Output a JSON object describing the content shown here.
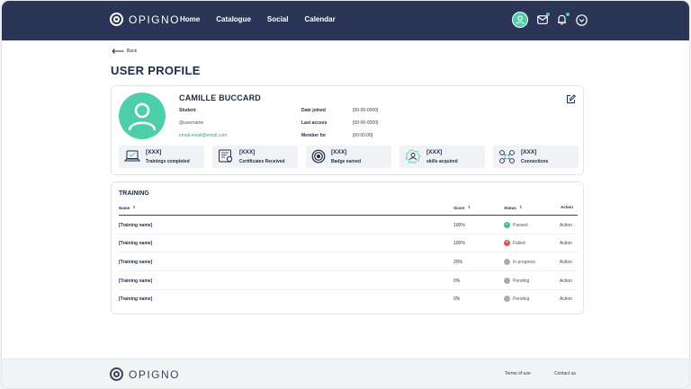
{
  "header": {
    "logo_text": "OPIGNO",
    "nav": [
      "Home",
      "Catalogue",
      "Social",
      "Calendar"
    ]
  },
  "back_label": "Back",
  "page_title": "USER PROFILE",
  "profile": {
    "name": "CAMILLE BUCCARD",
    "role": "Student",
    "username": "@username",
    "email": "email.email@email.com",
    "meta": [
      {
        "label": "Date joined",
        "value": "[00-00-0000]"
      },
      {
        "label": "Last access",
        "value": "[00-00-0000]"
      },
      {
        "label": "Member for",
        "value": "[00:00:00]"
      }
    ],
    "stats": [
      {
        "value": "[XXX]",
        "label": "Trainings completed",
        "icon": "laptop-icon"
      },
      {
        "value": "[XXX]",
        "label": "Certificates Received",
        "icon": "certificate-icon"
      },
      {
        "value": "[XXX]",
        "label": "Badge earned",
        "icon": "badge-icon"
      },
      {
        "value": "[XXX]",
        "label": "skills acquired",
        "icon": "skills-icon"
      },
      {
        "value": "[XXX]",
        "label": "Connections",
        "icon": "connections-icon"
      }
    ]
  },
  "training": {
    "title": "TRAINING",
    "columns": {
      "name": "Name",
      "score": "Score",
      "status": "Status",
      "action": "Action"
    },
    "rows": [
      {
        "name": "[Training name]",
        "score": "100%",
        "status": "Passed",
        "action": "Action"
      },
      {
        "name": "[Training name]",
        "score": "100%",
        "status": "Failed",
        "action": "Action"
      },
      {
        "name": "[Training name]",
        "score": "20%",
        "status": "In progress",
        "action": "Action"
      },
      {
        "name": "[Training name]",
        "score": "0%",
        "status": "Pending",
        "action": "Action"
      },
      {
        "name": "[Training name]",
        "score": "0%",
        "status": "Pending",
        "action": "Action"
      }
    ]
  },
  "footer": {
    "logo_text": "OPIGNO",
    "terms": "Terms of use",
    "contact": "Contact us"
  },
  "colors": {
    "header_bg": "#2b3556",
    "accent": "#4dcfa9",
    "passed": "#3cc08f",
    "failed": "#e05252",
    "neutral": "#a9acb3"
  }
}
